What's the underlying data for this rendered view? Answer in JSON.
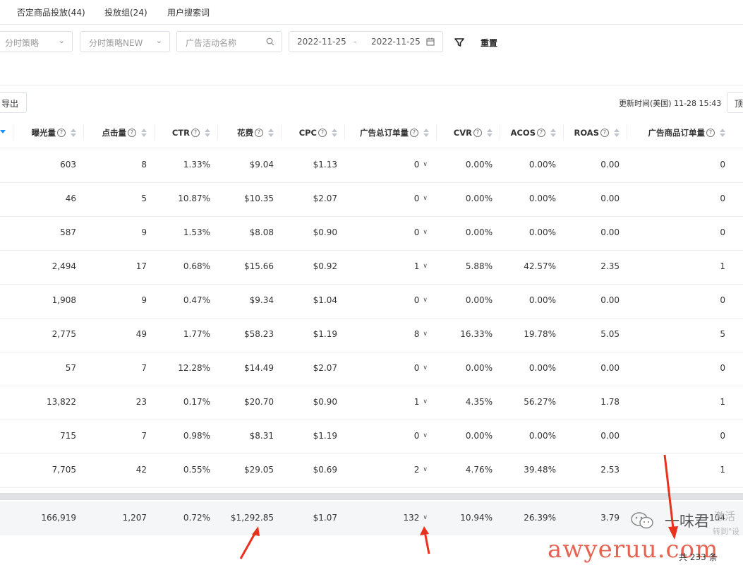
{
  "tabs": [
    "否定商品投放(44)",
    "投放组(24)",
    "用户搜索词"
  ],
  "filters": {
    "strategy_placeholder": "分时策略",
    "strategy_new_placeholder": "分时策略NEW",
    "campaign_placeholder": "广告活动名称",
    "date_start": "2022-11-25",
    "date_sep": "-",
    "date_end": "2022-11-25",
    "reset_label": "重置"
  },
  "toolbar": {
    "export_label": "导出",
    "update_time": "更新时间(美国) 11-28 15:43",
    "top_label": "顶"
  },
  "columns": [
    "曝光量",
    "点击量",
    "CTR",
    "花费",
    "CPC",
    "广告总订单量",
    "CVR",
    "ACOS",
    "ROAS",
    "广告商品订单量"
  ],
  "rows": [
    [
      "603",
      "8",
      "1.33%",
      "$9.04",
      "$1.13",
      "0",
      "0.00%",
      "0.00%",
      "0.00",
      "0"
    ],
    [
      "46",
      "5",
      "10.87%",
      "$10.35",
      "$2.07",
      "0",
      "0.00%",
      "0.00%",
      "0.00",
      "0"
    ],
    [
      "587",
      "9",
      "1.53%",
      "$8.08",
      "$0.90",
      "0",
      "0.00%",
      "0.00%",
      "0.00",
      "0"
    ],
    [
      "2,494",
      "17",
      "0.68%",
      "$15.66",
      "$0.92",
      "1",
      "5.88%",
      "42.57%",
      "2.35",
      "1"
    ],
    [
      "1,908",
      "9",
      "0.47%",
      "$9.34",
      "$1.04",
      "0",
      "0.00%",
      "0.00%",
      "0.00",
      "0"
    ],
    [
      "2,775",
      "49",
      "1.77%",
      "$58.23",
      "$1.19",
      "8",
      "16.33%",
      "19.78%",
      "5.05",
      "5"
    ],
    [
      "57",
      "7",
      "12.28%",
      "$14.49",
      "$2.07",
      "0",
      "0.00%",
      "0.00%",
      "0.00",
      "0"
    ],
    [
      "13,822",
      "23",
      "0.17%",
      "$20.70",
      "$0.90",
      "1",
      "4.35%",
      "56.27%",
      "1.78",
      "1"
    ],
    [
      "715",
      "7",
      "0.98%",
      "$8.31",
      "$1.19",
      "0",
      "0.00%",
      "0.00%",
      "0.00",
      "0"
    ],
    [
      "7,705",
      "42",
      "0.55%",
      "$29.05",
      "$0.69",
      "2",
      "4.76%",
      "39.48%",
      "2.53",
      "1"
    ]
  ],
  "totals": [
    "166,919",
    "1,207",
    "0.72%",
    "$1,292.85",
    "$1.07",
    "132",
    "10.94%",
    "26.39%",
    "3.79",
    "104"
  ],
  "pagination": {
    "total_label": "共 233 条"
  },
  "watermark": {
    "text": "awyeruu.com",
    "name": "一味君",
    "faint_1": "激活",
    "faint_2": "转到\"设",
    "color": "#e24834"
  },
  "annotation_color": "#e8321e"
}
